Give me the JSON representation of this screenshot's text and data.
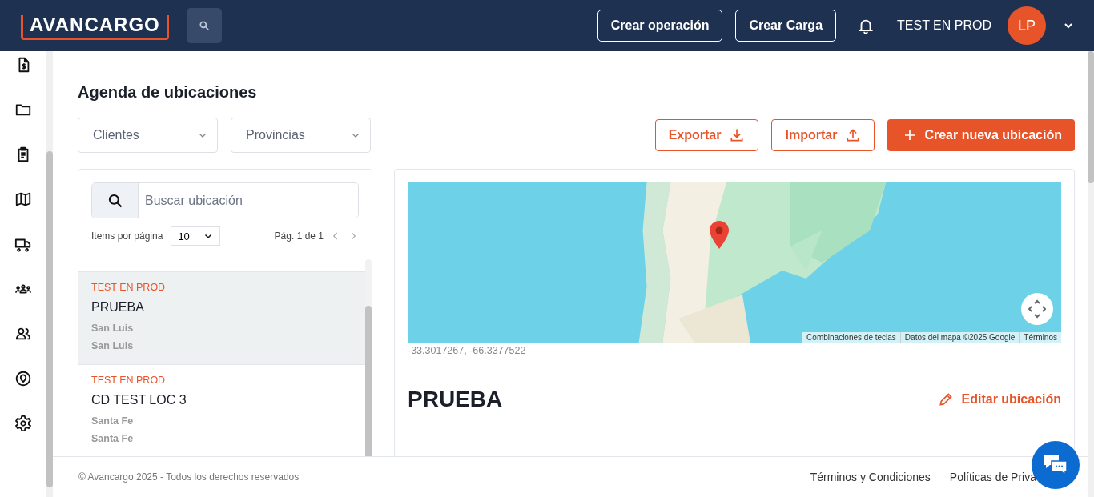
{
  "header": {
    "logo": "AVANCARGO",
    "buttons": [
      "Crear operación",
      "Crear Carga"
    ],
    "user_name": "TEST EN PROD",
    "avatar": "LP"
  },
  "sidebar": {
    "items": [
      {
        "kind": "invoice"
      },
      {
        "kind": "folder"
      },
      {
        "kind": "clipboard"
      },
      {
        "kind": "map"
      },
      {
        "kind": "truck"
      },
      {
        "kind": "group"
      },
      {
        "kind": "users"
      },
      {
        "kind": "location"
      },
      {
        "kind": "settings"
      }
    ]
  },
  "page_title": "Agenda de ubicaciones",
  "filters": [
    {
      "label": "Clientes"
    },
    {
      "label": "Provincias"
    }
  ],
  "actions": [
    {
      "label": "Exportar",
      "kind": "export"
    },
    {
      "label": "Importar",
      "kind": "import"
    },
    {
      "label": "Crear nueva ubicación",
      "kind": "create"
    }
  ],
  "list": {
    "search": {
      "placeholder": "Buscar ubicación"
    },
    "items_per_page_label": "Items por página",
    "items_per_page": "10",
    "page_info": "Pág. 1 de 1",
    "locations": [
      {
        "client": "TEST EN PROD",
        "name": "PRUEBA",
        "line_1": "San Luis",
        "line_2": "San Luis",
        "selected": true
      },
      {
        "client": "TEST EN PROD",
        "name": "CD TEST LOC 3",
        "line_1": "Santa Fe",
        "line_2": "Santa Fe",
        "selected": false
      }
    ]
  },
  "detail": {
    "map": {
      "kind": "picture",
      "attribution": [
        "Combinaciones de teclas",
        "Datos del mapa ©2025 Google",
        "Términos"
      ]
    },
    "coordinates": "-33.3017267, -66.3377522",
    "title": "PRUEBA",
    "edit_link": "Editar ubicación"
  },
  "footer": {
    "copyright": "© Avancargo 2025 - Todos los derechos reservados",
    "links": [
      "Términos y Condiciones",
      "Políticas de Priva"
    ]
  }
}
